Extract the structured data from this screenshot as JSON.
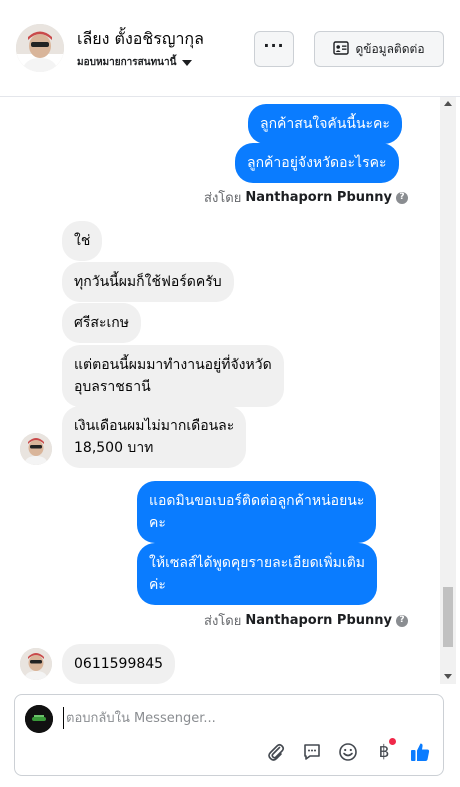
{
  "header": {
    "contact_name": "เลียง ตั้งอชิรญากุล",
    "assign_label": "มอบหมายการสนทนานี้",
    "more_label": "···",
    "contact_info_label": "ดูข้อมูลติดต่อ"
  },
  "messages": [
    {
      "side": "outgoing",
      "text": "ลูกค้าสนใจคันนี้นะคะ"
    },
    {
      "side": "outgoing",
      "text": "ลูกค้าอยู่จังหวัดอะไรคะ"
    },
    {
      "side": "sent_by",
      "prefix": "ส่งโดย",
      "name": "Nanthaporn Pbunny"
    },
    {
      "side": "incoming",
      "text": "ใช่"
    },
    {
      "side": "incoming",
      "text": "ทุกวันนี้ผมก็ใช้ฟอร์ดครับ"
    },
    {
      "side": "incoming",
      "text": "ศรีสะเกษ"
    },
    {
      "side": "incoming",
      "lines": [
        "แต่ตอนนี้ผมมาทำงานอยู่ที่จังหวัด",
        "อุบลราชธานี"
      ]
    },
    {
      "side": "incoming",
      "lines": [
        "เงินเดือนผมไม่มากเดือนละ",
        "18,500 บาท"
      ]
    },
    {
      "side": "outgoing",
      "lines": [
        "แอดมินขอเบอร์ติดต่อลูกค้าหน่อยนะ",
        "คะ"
      ]
    },
    {
      "side": "outgoing",
      "lines": [
        "ให้เซลส์ได้พูดคุยรายละเอียดเพิ่มเติม",
        "ค่ะ"
      ]
    },
    {
      "side": "sent_by",
      "prefix": "ส่งโดย",
      "name": "Nanthaporn Pbunny"
    },
    {
      "side": "incoming",
      "text": "0611599845"
    }
  ],
  "composer": {
    "placeholder": "ตอบกลับใน Messenger..."
  },
  "colors": {
    "outgoing_bubble": "#0a7cff",
    "incoming_bubble": "#f0f0f0",
    "like_icon": "#0a7cff",
    "notification_dot": "#f02849"
  },
  "icons": [
    "attachment-icon",
    "saved-replies-icon",
    "emoji-icon",
    "payment-icon",
    "like-icon"
  ]
}
